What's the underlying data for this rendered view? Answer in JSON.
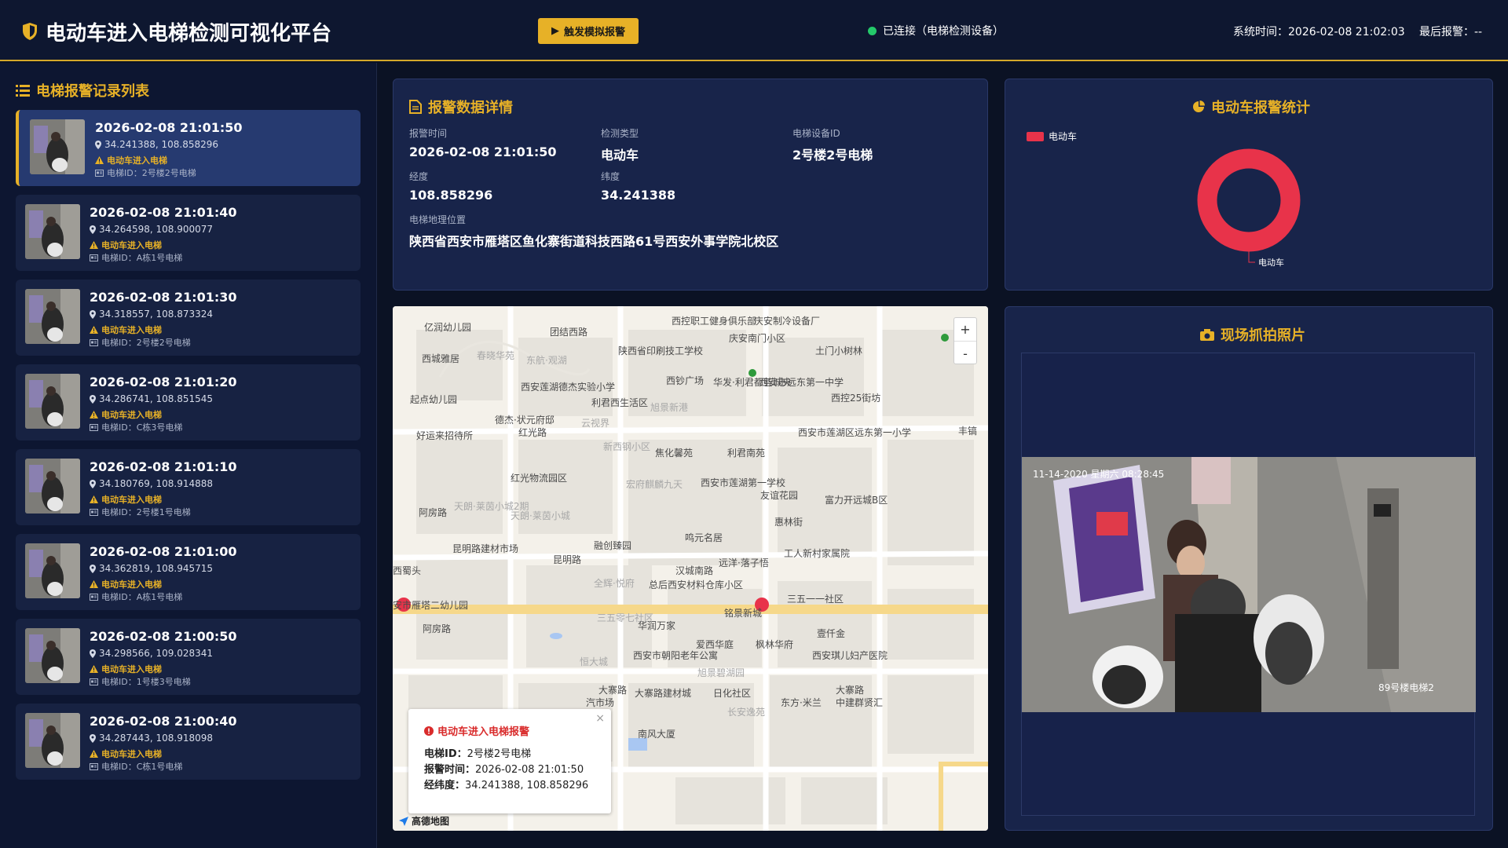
{
  "header": {
    "title": "电动车进入电梯检测可视化平台",
    "simulate_button": "触发模拟报警",
    "connection_status": "已连接（电梯检测设备）",
    "system_time": "系统时间：2026-02-08 21:02:03",
    "last_alarm": "最后报警：--",
    "accent_color": "#e7b127",
    "connected_color": "#24c96a"
  },
  "sidebar": {
    "title": "电梯报警记录列表",
    "records": [
      {
        "time": "2026-02-08 21:01:50",
        "coord": "34.241388, 108.858296",
        "alarm": "电动车进入电梯",
        "elevator": "电梯ID：2号楼2号电梯"
      },
      {
        "time": "2026-02-08 21:01:40",
        "coord": "34.264598, 108.900077",
        "alarm": "电动车进入电梯",
        "elevator": "电梯ID：A栋1号电梯"
      },
      {
        "time": "2026-02-08 21:01:30",
        "coord": "34.318557, 108.873324",
        "alarm": "电动车进入电梯",
        "elevator": "电梯ID：2号楼2号电梯"
      },
      {
        "time": "2026-02-08 21:01:20",
        "coord": "34.286741, 108.851545",
        "alarm": "电动车进入电梯",
        "elevator": "电梯ID：C栋3号电梯"
      },
      {
        "time": "2026-02-08 21:01:10",
        "coord": "34.180769, 108.914888",
        "alarm": "电动车进入电梯",
        "elevator": "电梯ID：2号楼1号电梯"
      },
      {
        "time": "2026-02-08 21:01:00",
        "coord": "34.362819, 108.945715",
        "alarm": "电动车进入电梯",
        "elevator": "电梯ID：A栋1号电梯"
      },
      {
        "time": "2026-02-08 21:00:50",
        "coord": "34.298566, 109.028341",
        "alarm": "电动车进入电梯",
        "elevator": "电梯ID：1号楼3号电梯"
      },
      {
        "time": "2026-02-08 21:00:40",
        "coord": "34.287443, 108.918098",
        "alarm": "电动车进入电梯",
        "elevator": "电梯ID：C栋1号电梯"
      }
    ]
  },
  "details": {
    "title": "报警数据详情",
    "alarm_time_label": "报警时间",
    "alarm_time": "2026-02-08 21:01:50",
    "type_label": "检测类型",
    "type": "电动车",
    "device_label": "电梯设备ID",
    "device": "2号楼2号电梯",
    "lng_label": "经度",
    "lng": "108.858296",
    "lat_label": "纬度",
    "lat": "34.241388",
    "location_label": "电梯地理位置",
    "location": "陕西省西安市雁塔区鱼化寨街道科技西路61号西安外事学院北校区"
  },
  "stats": {
    "title": "电动车报警统计",
    "legend": "电动车",
    "slice_label": "电动车",
    "color": "#e8334a",
    "chart_data": {
      "type": "pie",
      "categories": [
        "电动车"
      ],
      "values": [
        1
      ]
    }
  },
  "map": {
    "zoom_in": "+",
    "zoom_out": "-",
    "logo": "高德地图",
    "labels": [
      "亿润幼儿园",
      "团结西路",
      "西控职工健身俱乐部",
      "庆安制冷设备厂",
      "庆安南门小区",
      "土门小树林",
      "陕西省印刷技工学校",
      "西城雅居",
      "春晓华苑",
      "东航·观湖",
      "西钞广场",
      "华发·利君都荟城央",
      "西安市远东第一中学",
      "起点幼儿园",
      "西安莲湖德杰实验小学",
      "利君西生活区",
      "旭景新港",
      "西控25街坊",
      "好运来招待所",
      "德杰·状元府邸",
      "云视界",
      "红光路",
      "西安市莲湖区远东第一小学",
      "新西钢小区",
      "焦化馨苑",
      "利君南苑",
      "红光物流园区",
      "宏府麒麟九天",
      "西安市莲湖第一学校",
      "友谊花园",
      "富力开远城B区",
      "天朗·莱茵小城2期",
      "天朗·莱茵小城",
      "惠林街",
      "阿房路",
      "融创臻园",
      "鸣元名居",
      "昆明路建材市场",
      "昆明路",
      "汉城南路",
      "远洋·落子悟",
      "工人新村家属院",
      "西蜀头",
      "全辉·悦府",
      "总后西安材料仓库小区",
      "三五一一社区",
      "安市雁塔二幼儿园",
      "铭景新城",
      "三五零七社区",
      "华润万家",
      "壹仟金",
      "阿房路",
      "爱西华庭",
      "枫林华府",
      "西安市朝阳老年公寓",
      "西安琪儿妇产医院",
      "恒大城",
      "旭景碧湖园",
      "大寨路",
      "大寨路建材城",
      "日化社区",
      "东方·米兰",
      "中建群贤汇",
      "大寨路",
      "南风大厦",
      "长安逸苑",
      "汽市场",
      "丰镐"
    ],
    "popup": {
      "title": "电动车进入电梯报警",
      "elevator_label": "电梯ID：",
      "elevator": "2号楼2号电梯",
      "time_label": "报警时间：",
      "time": "2026-02-08 21:01:50",
      "coord_label": "经纬度：",
      "coord": "34.241388, 108.858296",
      "close": "×"
    }
  },
  "photo": {
    "title": "现场抓拍照片",
    "timestamp": "11-14-2020 星期六 08:28:45",
    "caption": "89号楼电梯2"
  }
}
